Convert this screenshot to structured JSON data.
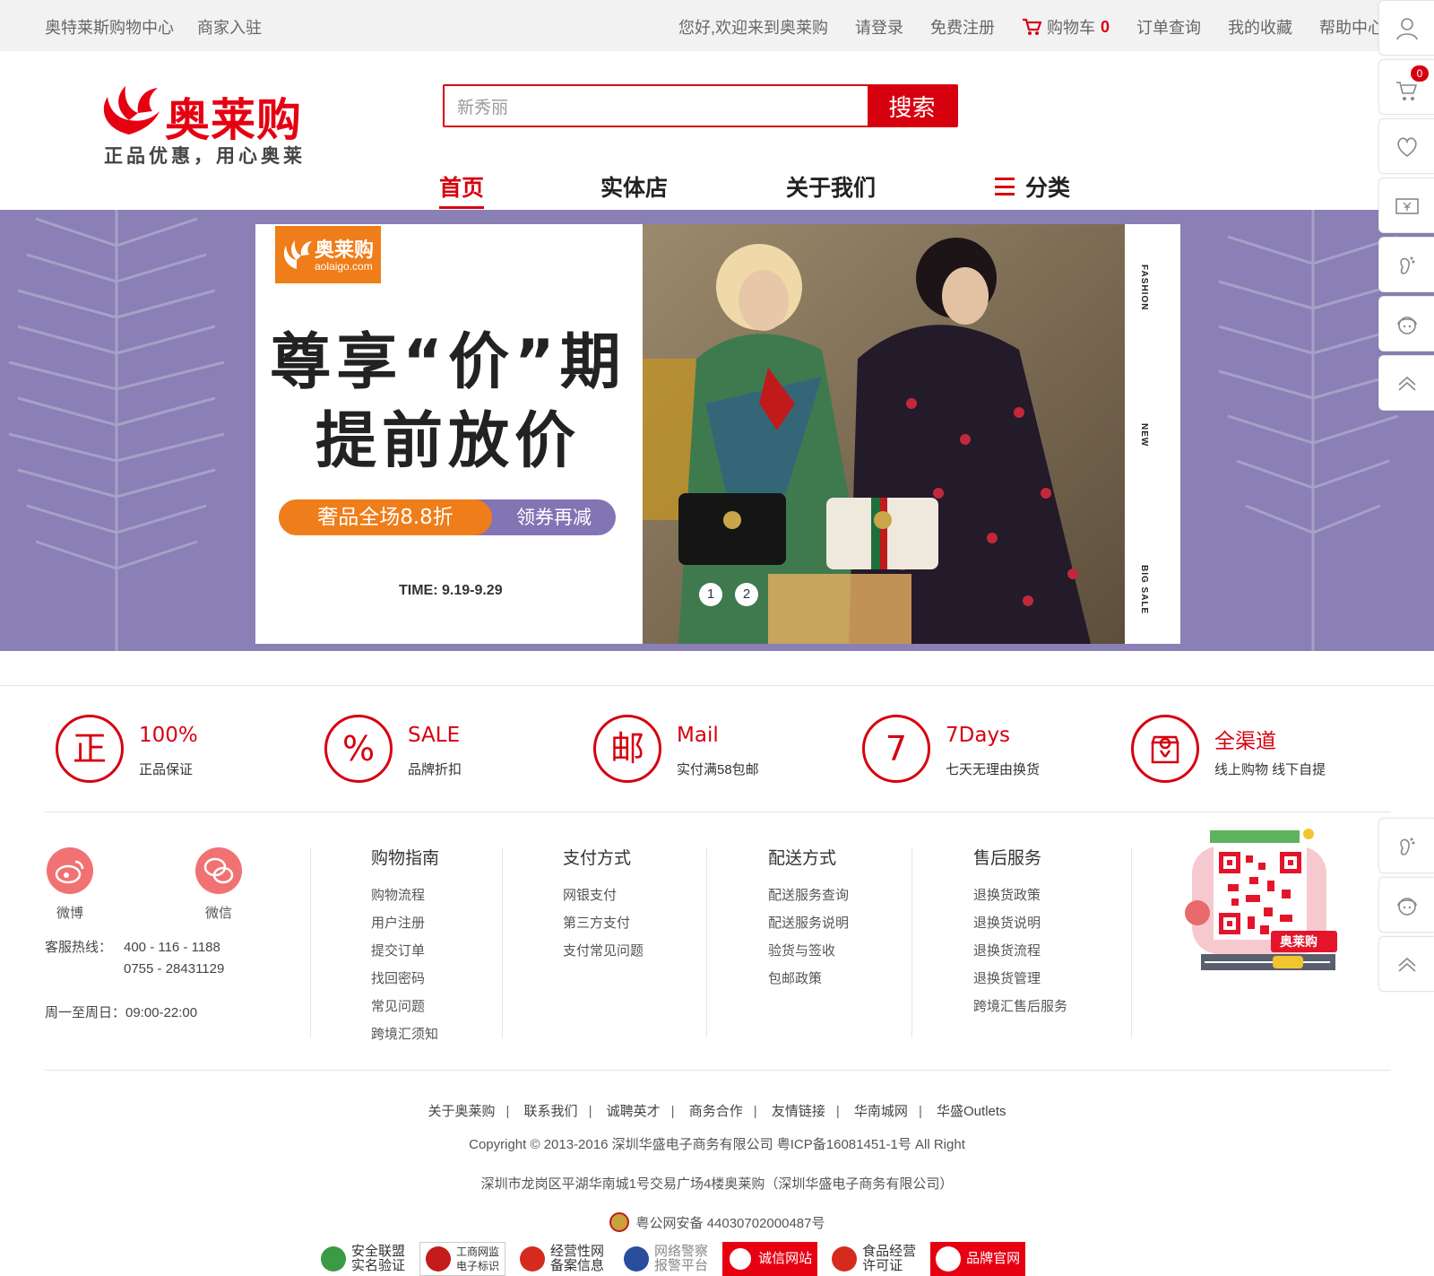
{
  "topbar": {
    "left_links": [
      "奥特莱斯购物中心",
      "商家入驻"
    ],
    "welcome": "您好,欢迎来到奥莱购",
    "login": "请登录",
    "register": "免费注册",
    "cart_label": "购物车",
    "cart_count": "0",
    "order_query": "订单查询",
    "favorites": "我的收藏",
    "help": "帮助中心"
  },
  "header": {
    "logo_name": "奥莱购",
    "logo_slogan": "正品优惠，用心奥莱",
    "search_value": "新秀丽",
    "search_button": "搜索"
  },
  "nav": {
    "items": [
      "首页",
      "实体店",
      "关于我们",
      "分类"
    ],
    "active_index": 0
  },
  "banner": {
    "logo_cn": "奥莱购",
    "logo_en": "aolaigo.com",
    "headline_1": "尊享“价”期",
    "headline_2": "提前放价",
    "pill_left": "奢品全场8.8折",
    "pill_right": "领券再减",
    "time": "TIME: 9.19-9.29",
    "side_labels": [
      "FASHION",
      "NEW",
      "BIG SALE"
    ],
    "slides": [
      "1",
      "2"
    ],
    "background_color": "#8a80b5",
    "accent_orange": "#ef7d1a"
  },
  "features": [
    {
      "icon_char": "正",
      "title": "100%",
      "desc": "正品保证"
    },
    {
      "icon_char": "%",
      "title": "SALE",
      "desc": "品牌折扣"
    },
    {
      "icon_char": "邮",
      "title": "Mail",
      "desc": "实付满58包邮"
    },
    {
      "icon_char": "7",
      "title": "7Days",
      "desc": "七天无理由换货"
    },
    {
      "icon_char": "",
      "title": "全渠道",
      "desc": "线上购物 线下自提"
    }
  ],
  "footer": {
    "social": [
      {
        "label": "微博",
        "icon": "weibo-icon"
      },
      {
        "label": "微信",
        "icon": "wechat-icon"
      }
    ],
    "hotline_label": "客服热线：",
    "hotline_1": "400 - 116 - 1188",
    "hotline_2": "0755 - 28431129",
    "hours": "周一至周日：09:00-22:00",
    "columns": [
      {
        "title": "购物指南",
        "links": [
          "购物流程",
          "用户注册",
          "提交订单",
          "找回密码",
          "常见问题",
          "跨境汇须知"
        ]
      },
      {
        "title": "支付方式",
        "links": [
          "网银支付",
          "第三方支付",
          "支付常见问题"
        ]
      },
      {
        "title": "配送方式",
        "links": [
          "配送服务查询",
          "配送服务说明",
          "验货与签收",
          "包邮政策"
        ]
      },
      {
        "title": "售后服务",
        "links": [
          "退换货政策",
          "退换货说明",
          "退换货流程",
          "退换货管理",
          "跨境汇售后服务"
        ]
      }
    ],
    "qr_brand": "奥莱购",
    "bottom_links": [
      "关于奥莱购",
      "联系我们",
      "诚聘英才",
      "商务合作",
      "友情链接",
      "华南城网",
      "华盛Outlets"
    ],
    "copyright": "Copyright © 2013-2016 深圳华盛电子商务有限公司 粤ICP备16081451-1号 All Right",
    "address": "深圳市龙岗区平湖华南城1号交易广场4楼奥莱购（深圳华盛电子商务有限公司）",
    "police": "粤公网安备 44030702000487号",
    "badges": [
      {
        "line1": "安全联盟",
        "line2": "实名验证"
      },
      {
        "line1": "工商网监",
        "line2": "电子标识"
      },
      {
        "line1": "经营性网",
        "line2": "备案信息"
      },
      {
        "line1": "网络警察",
        "line2": "报警平台"
      },
      {
        "line1": "诚信网站",
        "line2": ""
      },
      {
        "line1": "食品经营",
        "line2": "许可证"
      },
      {
        "line1": "品牌官网",
        "line2": ""
      }
    ]
  },
  "sidebar": {
    "cart_badge": "0",
    "icons": [
      "user-icon",
      "cart-icon",
      "heart-icon",
      "coupon-icon",
      "footprint-icon",
      "service-icon",
      "back-to-top-icon"
    ]
  },
  "colors": {
    "brand_red": "#d7000f",
    "feature_red": "#d7000f",
    "social_pink": "#f17273"
  }
}
